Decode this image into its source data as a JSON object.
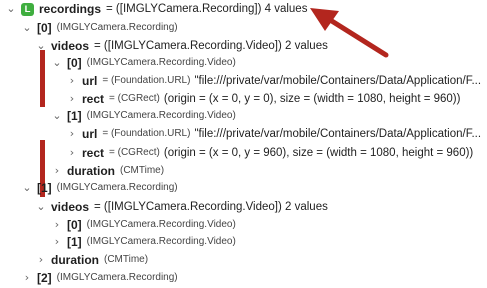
{
  "tree": {
    "r0": {
      "badge": "L",
      "key": "recordings",
      "value": "= ([IMGLYCamera.Recording]) 4 values"
    },
    "r1": {
      "key": "[0]",
      "type": "(IMGLYCamera.Recording)"
    },
    "r2": {
      "key": "videos",
      "value": "= ([IMGLYCamera.Recording.Video]) 2 values"
    },
    "r3": {
      "key": "[0]",
      "type": "(IMGLYCamera.Recording.Video)"
    },
    "r4": {
      "key": "url",
      "type": "= (Foundation.URL)",
      "value": "\"file:///private/var/mobile/Containers/Data/Application/F..."
    },
    "r5": {
      "key": "rect",
      "type": "= (CGRect)",
      "value": "(origin = (x = 0, y = 0), size = (width = 1080, height = 960))"
    },
    "r6": {
      "key": "[1]",
      "type": "(IMGLYCamera.Recording.Video)"
    },
    "r7": {
      "key": "url",
      "type": "= (Foundation.URL)",
      "value": "\"file:///private/var/mobile/Containers/Data/Application/F..."
    },
    "r8": {
      "key": "rect",
      "type": "= (CGRect)",
      "value": "(origin = (x = 0, y = 960), size = (width = 1080, height = 960))"
    },
    "r9": {
      "key": "duration",
      "type": "(CMTime)"
    },
    "r10": {
      "key": "[1]",
      "type": "(IMGLYCamera.Recording)"
    },
    "r11": {
      "key": "videos",
      "value": "= ([IMGLYCamera.Recording.Video]) 2 values"
    },
    "r12": {
      "key": "[0]",
      "type": "(IMGLYCamera.Recording.Video)"
    },
    "r13": {
      "key": "[1]",
      "type": "(IMGLYCamera.Recording.Video)"
    },
    "r14": {
      "key": "duration",
      "type": "(CMTime)"
    },
    "r15": {
      "key": "[2]",
      "type": "(IMGLYCamera.Recording)"
    }
  },
  "colors": {
    "badge": "#3fae3f",
    "annotation": "#b3261e"
  },
  "icons": {
    "expanded": "chevron-down-icon",
    "collapsed": "chevron-right-icon"
  }
}
